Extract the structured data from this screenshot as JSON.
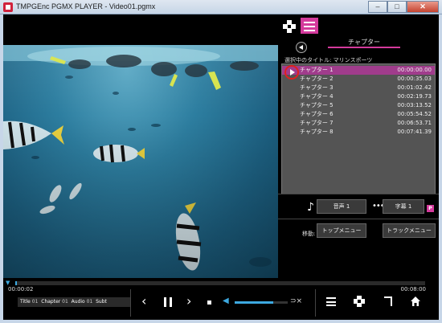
{
  "window": {
    "title": "TMPGEnc PGMX PLAYER - Video01.pgmx",
    "minimize": "–",
    "maximize": "□",
    "close": "✕"
  },
  "panel": {
    "header": "チャプター",
    "selected_title": "選択中のタイトル: マリンスポーツ",
    "chapters": [
      {
        "name": "チャプター 1",
        "time": "00:00:00.00",
        "selected": true
      },
      {
        "name": "チャプター 2",
        "time": "00:00:35.03",
        "selected": false
      },
      {
        "name": "チャプター 3",
        "time": "00:01:02.42",
        "selected": false
      },
      {
        "name": "チャプター 4",
        "time": "00:02:19.73",
        "selected": false
      },
      {
        "name": "チャプター 5",
        "time": "00:03:13.52",
        "selected": false
      },
      {
        "name": "チャプター 6",
        "time": "00:05:54.52",
        "selected": false
      },
      {
        "name": "チャプター 7",
        "time": "00:06:53.71",
        "selected": false
      },
      {
        "name": "チャプター 8",
        "time": "00:07:41.39",
        "selected": false
      }
    ],
    "audio_label": "音声 1",
    "subtitle_label": "字幕 1",
    "subtitle_badge": "P",
    "move_label": "移動:",
    "top_menu_label": "トップメニュー",
    "track_menu_label": "トラックメニュー"
  },
  "playback": {
    "elapsed": "00:00:02",
    "total": "00:08:00",
    "progress_fraction": 0.004,
    "volume_fraction": 0.72,
    "info": {
      "title_key": "Title",
      "title_val": "01",
      "chapter_key": "Chapter",
      "chapter_val": "01",
      "audio_key": "Audio",
      "audio_val": "01",
      "subt_key": "Subt"
    }
  },
  "colors": {
    "accent": "#d43a9c",
    "seek": "#3da9e0",
    "selected_row": "#a03c8c"
  },
  "icons": [
    "app-icon",
    "dpad-icon",
    "menu-icon",
    "back-icon",
    "play-icon",
    "music-note-icon",
    "dots-icon",
    "prev-icon",
    "pause-icon",
    "next-icon",
    "stop-icon",
    "volume-icon",
    "loop-icon",
    "hamburger-icon",
    "return-icon",
    "home-icon"
  ]
}
